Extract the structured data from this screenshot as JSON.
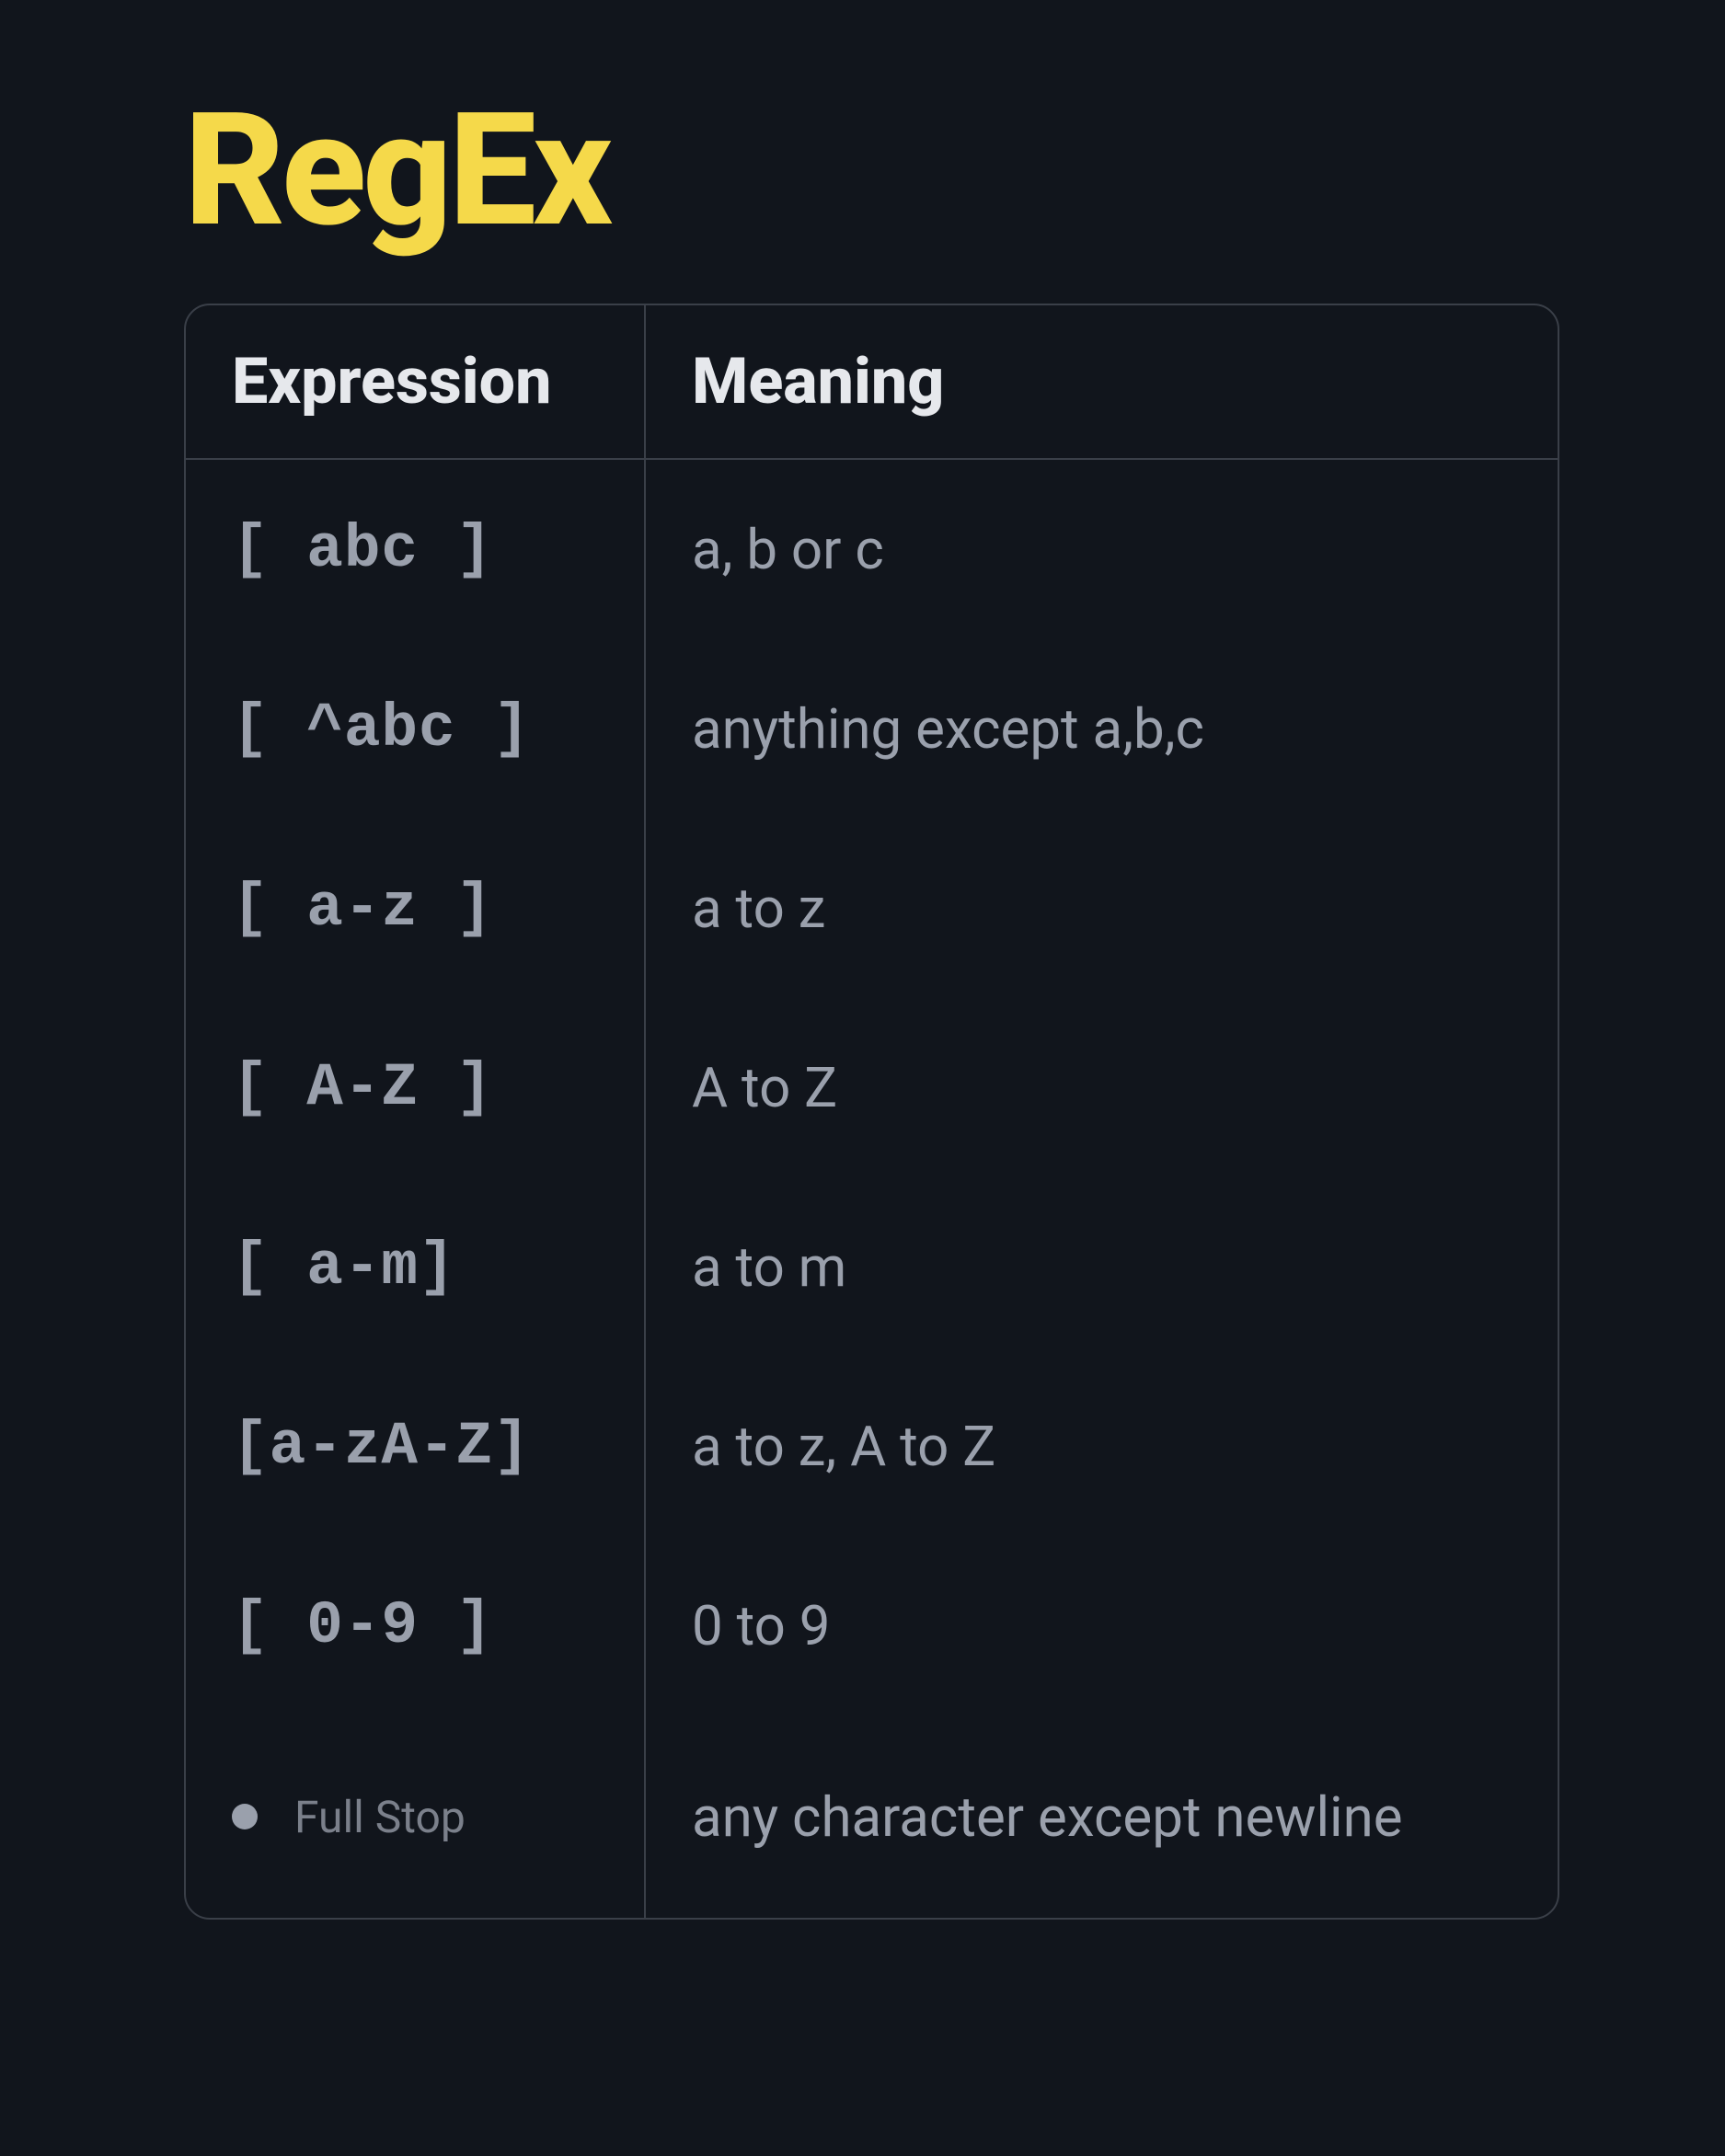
{
  "title": "RegEx",
  "headers": {
    "expression": "Expression",
    "meaning": "Meaning"
  },
  "rows": [
    {
      "expr": "[ abc ]",
      "meaning": "a, b or c"
    },
    {
      "expr": "[ ^abc ]",
      "meaning": "anything except a,b,c"
    },
    {
      "expr": "[ a-z ]",
      "meaning": "a to z"
    },
    {
      "expr": "[ A-Z ]",
      "meaning": "A to Z"
    },
    {
      "expr": "[ a-m]",
      "meaning": "a to m"
    },
    {
      "expr": "[a-zA-Z]",
      "meaning": "a to z,  A to Z"
    },
    {
      "expr": "[ 0-9 ]",
      "meaning": "0 to 9"
    },
    {
      "expr_is_dot": true,
      "dot_label": "Full Stop",
      "meaning": "any character except newline"
    }
  ]
}
